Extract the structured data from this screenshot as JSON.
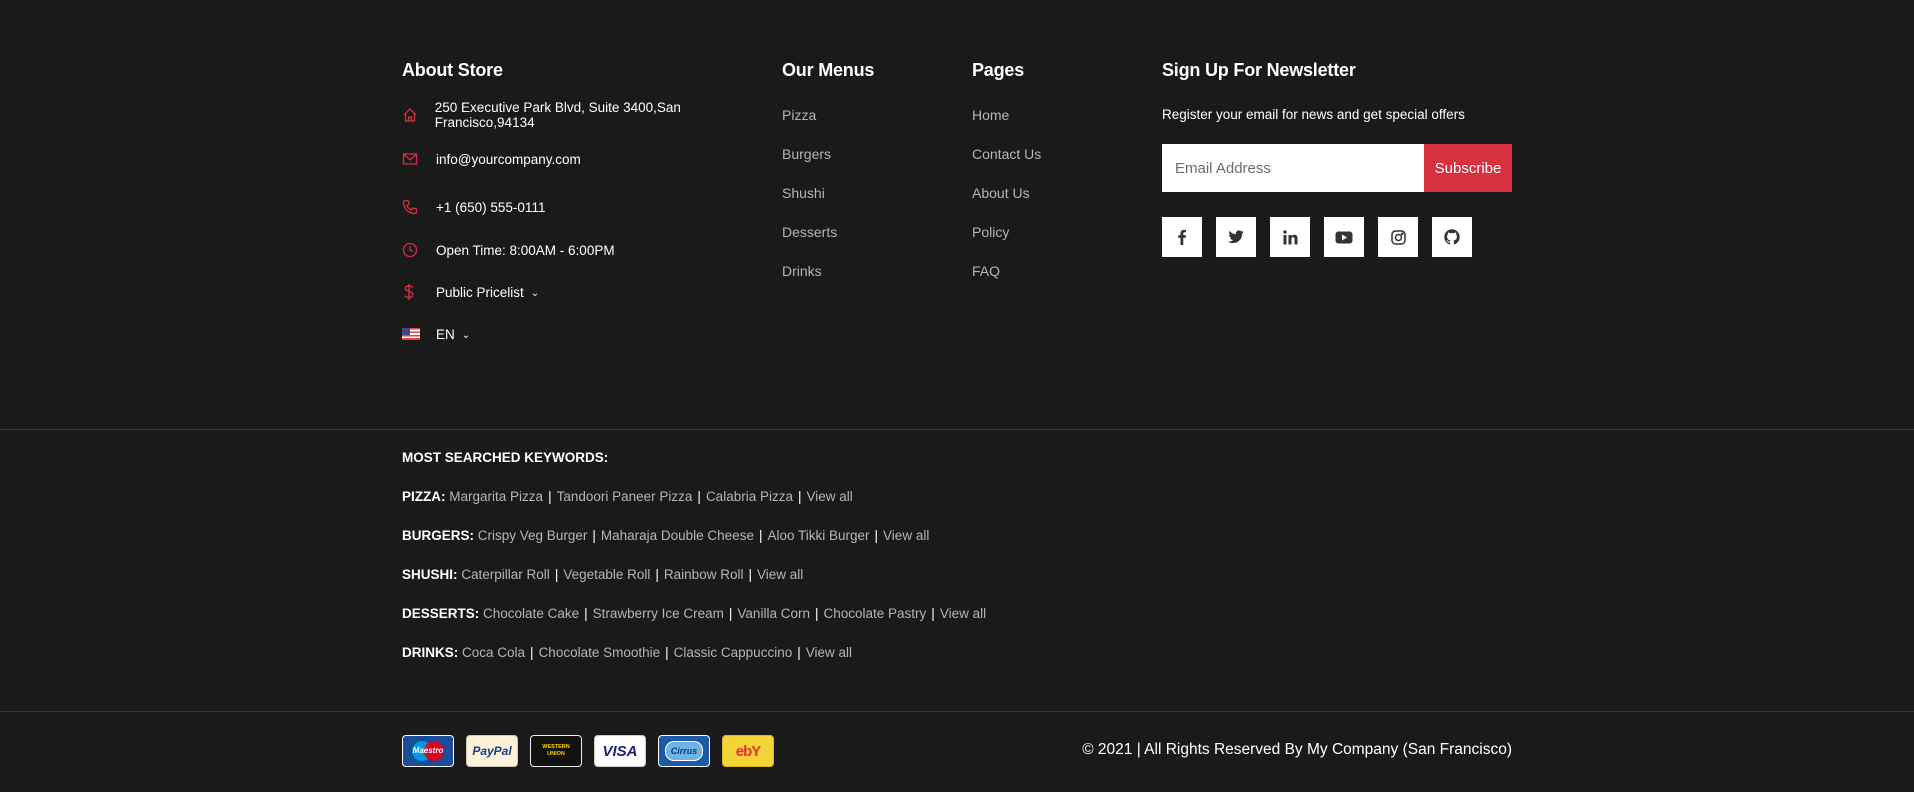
{
  "about": {
    "title": "About Store",
    "address": "250 Executive Park Blvd, Suite 3400,San Francisco,94134",
    "email": "info@yourcompany.com",
    "phone": "+1 (650) 555-0111",
    "hours": "Open Time: 8:00AM - 6:00PM",
    "pricelist": "Public Pricelist",
    "language": "EN"
  },
  "menus": {
    "title": "Our Menus",
    "items": [
      "Pizza",
      "Burgers",
      "Shushi",
      "Desserts",
      "Drinks"
    ]
  },
  "pages": {
    "title": "Pages",
    "items": [
      "Home",
      "Contact Us",
      "About Us",
      "Policy",
      "FAQ"
    ]
  },
  "newsletter": {
    "title": "Sign Up For Newsletter",
    "text": "Register your email for news and get special offers",
    "placeholder": "Email Address",
    "button": "Subscribe",
    "social": [
      "facebook-icon",
      "twitter-icon",
      "linkedin-icon",
      "youtube-icon",
      "instagram-icon",
      "github-icon"
    ]
  },
  "keywords": {
    "title": "MOST SEARCHED KEYWORDS:",
    "rows": [
      {
        "category": "PIZZA:",
        "items": [
          "Margarita Pizza",
          "Tandoori Paneer Pizza",
          "Calabria Pizza",
          "View all"
        ]
      },
      {
        "category": "BURGERS:",
        "items": [
          "Crispy Veg Burger",
          "Maharaja Double Cheese",
          "Aloo Tikki Burger",
          "View all"
        ]
      },
      {
        "category": "SHUSHI:",
        "items": [
          "Caterpillar Roll",
          "Vegetable Roll",
          "Rainbow Roll",
          "View all"
        ]
      },
      {
        "category": "DESSERTS:",
        "items": [
          "Chocolate Cake",
          "Strawberry Ice Cream",
          "Vanilla Corn",
          "Chocolate Pastry",
          "View all"
        ]
      },
      {
        "category": "DRINKS:",
        "items": [
          "Coca Cola",
          "Chocolate Smoothie",
          "Classic Cappuccino",
          "View all"
        ]
      }
    ]
  },
  "payments": [
    {
      "name": "maestro",
      "label": "Maestro"
    },
    {
      "name": "paypal",
      "label": "PayPal"
    },
    {
      "name": "western-union",
      "label": "WESTERN UNION"
    },
    {
      "name": "visa",
      "label": "VISA"
    },
    {
      "name": "cirrus",
      "label": "Cirrus"
    },
    {
      "name": "ebay",
      "label": "ebY"
    }
  ],
  "copyright": "© 2021 | All Rights Reserved By My Company (San Francisco)",
  "colors": {
    "accent": "#d7303f",
    "background": "#1b1a1b",
    "muted_link": "#b5b5b5"
  }
}
